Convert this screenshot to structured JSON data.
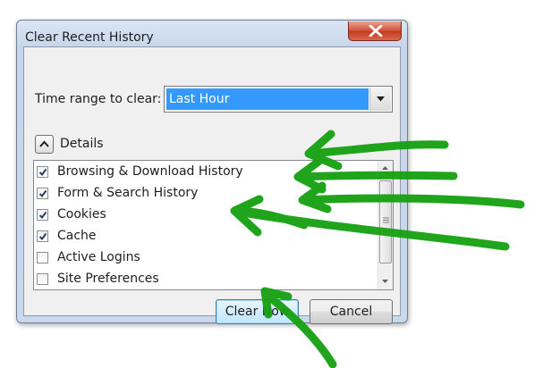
{
  "window": {
    "title": "Clear Recent History"
  },
  "time_range": {
    "label": "Time range to clear:",
    "selected": "Last Hour"
  },
  "details": {
    "label": "Details",
    "expanded": true
  },
  "items": [
    {
      "label": "Browsing & Download History",
      "checked": true
    },
    {
      "label": "Form & Search History",
      "checked": true
    },
    {
      "label": "Cookies",
      "checked": true
    },
    {
      "label": "Cache",
      "checked": true
    },
    {
      "label": "Active Logins",
      "checked": false
    },
    {
      "label": "Site Preferences",
      "checked": false
    }
  ],
  "buttons": {
    "clear": "Clear Now",
    "cancel": "Cancel"
  },
  "colors": {
    "selection": "#3399ff",
    "close_button": "#c33c22",
    "annotation": "#15a010"
  },
  "icons": {
    "close": "close-x-icon",
    "dropdown": "chevron-down-icon",
    "details": "chevron-up-icon",
    "check": "checkmark-icon"
  }
}
